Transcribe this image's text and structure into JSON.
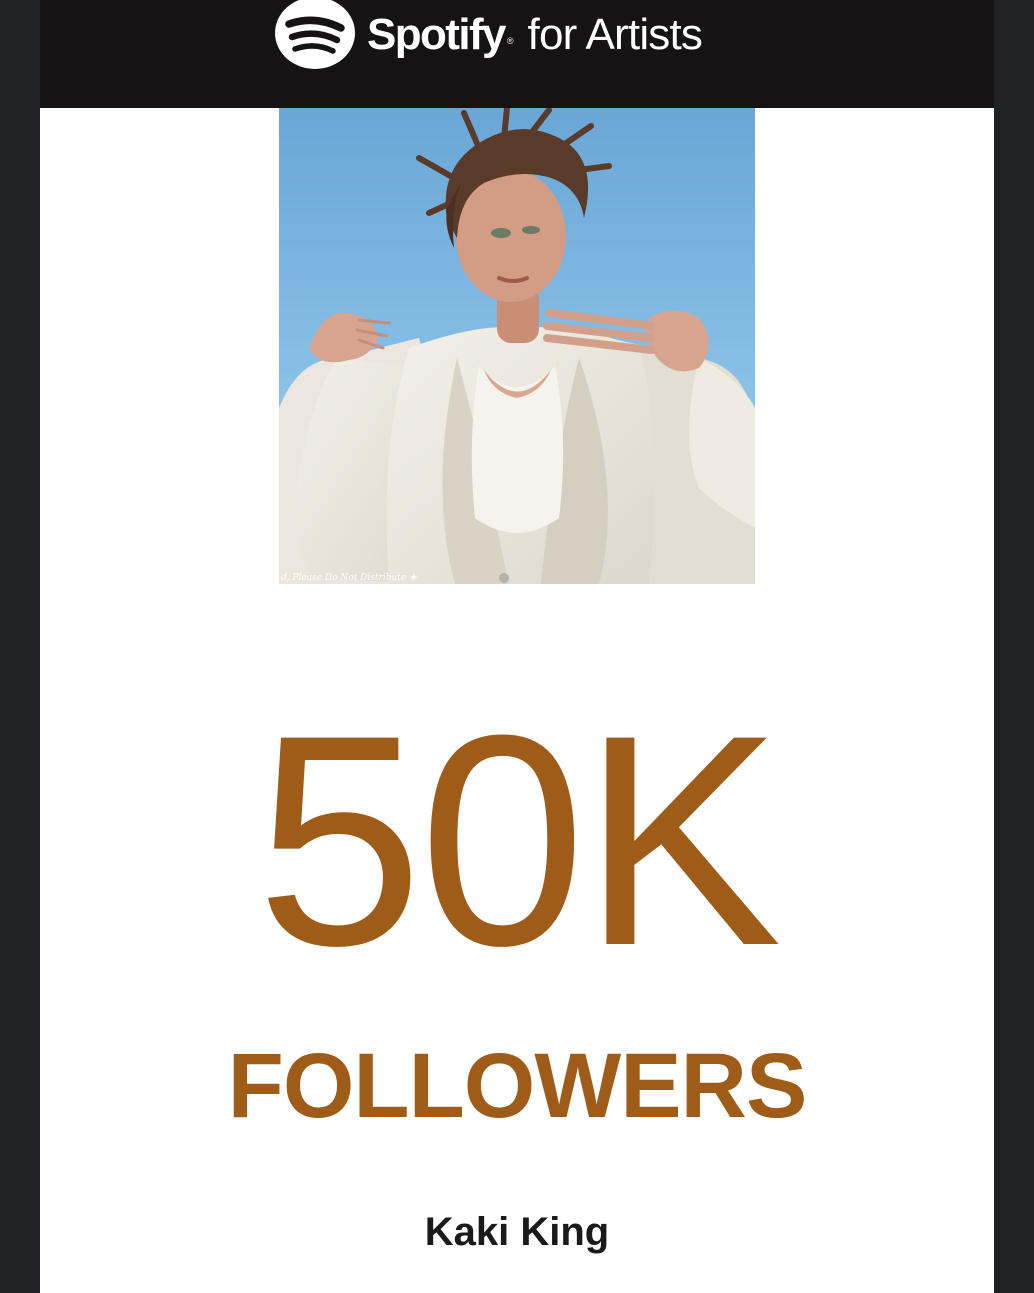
{
  "header": {
    "brand_name": "Spotify",
    "brand_registered": "®",
    "brand_suffix": "for Artists",
    "logo_icon": "spotify-logo-icon"
  },
  "photo": {
    "watermark": "d, Please Do Not Distribute ★"
  },
  "milestone": {
    "value": "50K",
    "label": "FOLLOWERS"
  },
  "artist": {
    "name": "Kaki King"
  },
  "colors": {
    "page_background": "#1f2124",
    "header_background": "#151314",
    "card_background": "#ffffff",
    "accent": "#9e5c18",
    "artist_text": "#1a1a1a",
    "sky": "#82bde6"
  }
}
